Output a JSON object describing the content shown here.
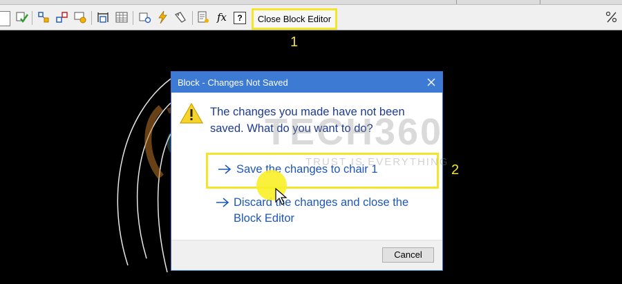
{
  "toolbar": {
    "icons": [
      "check-input-icon",
      "authoring-parameter-icon",
      "authoring-action-icon",
      "authoring-palette-icon",
      "block-table-icon",
      "table-grid-icon",
      "attribute-definition-icon",
      "lightning-icon",
      "define-attribute-icon",
      "block-properties-icon",
      "fx-icon",
      "help-icon"
    ],
    "fx_label": "fx",
    "help_label": "?",
    "close_block_editor": "Close Block Editor"
  },
  "callouts": {
    "one": "1",
    "two": "2"
  },
  "dialog": {
    "title": "Block - Changes Not Saved",
    "message": "The changes you made have not been saved. What do you want to do?",
    "save_option": "Save the changes to chair 1",
    "discard_option": "Discard the changes and close the Block Editor",
    "cancel": "Cancel"
  },
  "watermark": {
    "brand": "TECH360",
    "tagline": "TRUST IS EVERYTHING"
  },
  "colors": {
    "highlight": "#f3e52a",
    "title_bar": "#3d7ad3",
    "link": "#1c56b8",
    "message": "#1c3b8f"
  }
}
